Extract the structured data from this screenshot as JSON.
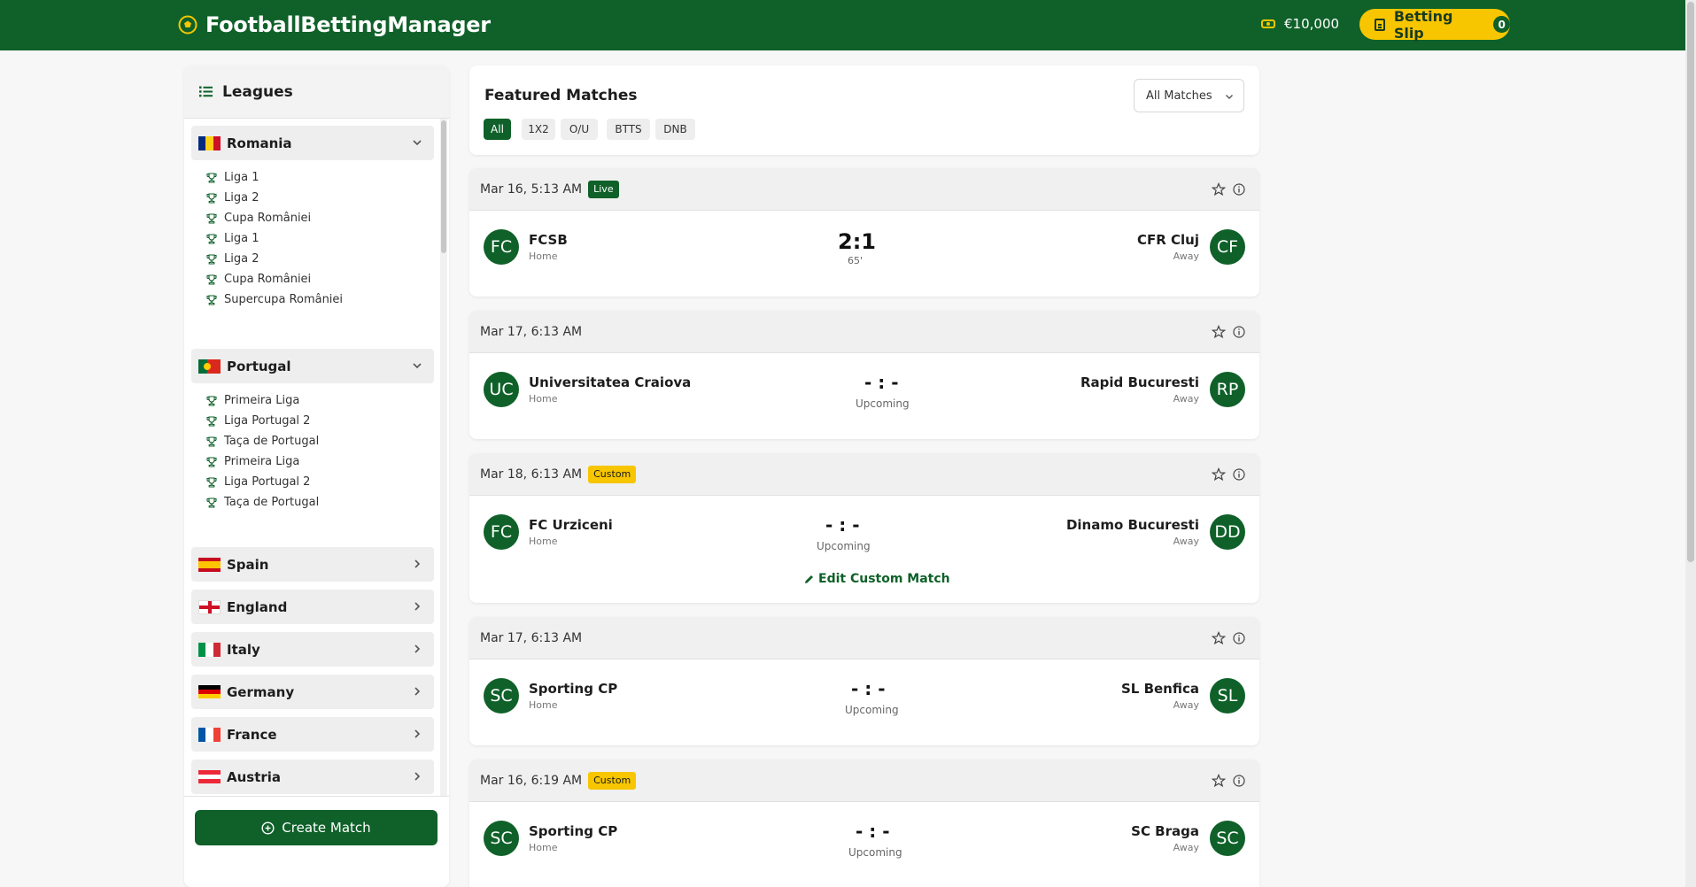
{
  "app": {
    "title": "FootballBettingManager"
  },
  "header": {
    "balance": "€10,000",
    "betting_slip_label": "Betting Slip",
    "betting_slip_count": "0"
  },
  "sidebar": {
    "title": "Leagues",
    "create_button_label": "Create Match",
    "countries": [
      {
        "name": "Romania",
        "expanded": true,
        "leagues": [
          "Liga 1",
          "Liga 2",
          "Cupa României",
          "Liga 1",
          "Liga 2",
          "Cupa României",
          "Supercupa României"
        ]
      },
      {
        "name": "Portugal",
        "expanded": true,
        "leagues": [
          "Primeira Liga",
          "Liga Portugal 2",
          "Taça de Portugal",
          "Primeira Liga",
          "Liga Portugal 2",
          "Taça de Portugal"
        ]
      },
      {
        "name": "Spain",
        "expanded": false
      },
      {
        "name": "England",
        "expanded": false
      },
      {
        "name": "Italy",
        "expanded": false
      },
      {
        "name": "Germany",
        "expanded": false
      },
      {
        "name": "France",
        "expanded": false
      },
      {
        "name": "Austria",
        "expanded": false
      }
    ]
  },
  "featured": {
    "title": "Featured Matches",
    "filter_select": "All Matches",
    "pills": [
      "All",
      "1X2",
      "O/U",
      "BTTS",
      "DNB"
    ],
    "active_pill": "All"
  },
  "matches": [
    {
      "date": "Mar 16, 5:13 AM",
      "badge": "Live",
      "home": {
        "initials": "FC",
        "name": "FCSB",
        "role": "Home"
      },
      "away": {
        "initials": "CF",
        "name": "CFR Cluj",
        "role": "Away"
      },
      "score": "2:1",
      "status": "65'"
    },
    {
      "date": "Mar 17, 6:13 AM",
      "badge": "",
      "home": {
        "initials": "UC",
        "name": "Universitatea Craiova",
        "role": "Home"
      },
      "away": {
        "initials": "RP",
        "name": "Rapid Bucuresti",
        "role": "Away"
      },
      "score": "- : -",
      "status": "Upcoming"
    },
    {
      "date": "Mar 18, 6:13 AM",
      "badge": "Custom",
      "home": {
        "initials": "FC",
        "name": "FC Urziceni",
        "role": "Home"
      },
      "away": {
        "initials": "DD",
        "name": "Dinamo Bucuresti",
        "role": "Away"
      },
      "score": "- : -",
      "status": "Upcoming",
      "edit_label": "Edit Custom Match"
    },
    {
      "date": "Mar 17, 6:13 AM",
      "badge": "",
      "home": {
        "initials": "SC",
        "name": "Sporting CP",
        "role": "Home"
      },
      "away": {
        "initials": "SL",
        "name": "SL Benfica",
        "role": "Away"
      },
      "score": "- : -",
      "status": "Upcoming"
    },
    {
      "date": "Mar 16, 6:19 AM",
      "badge": "Custom",
      "home": {
        "initials": "SC",
        "name": "Sporting CP",
        "role": "Home"
      },
      "away": {
        "initials": "SC",
        "name": "SC Braga",
        "role": "Away"
      },
      "score": "- : -",
      "status": "Upcoming"
    }
  ]
}
